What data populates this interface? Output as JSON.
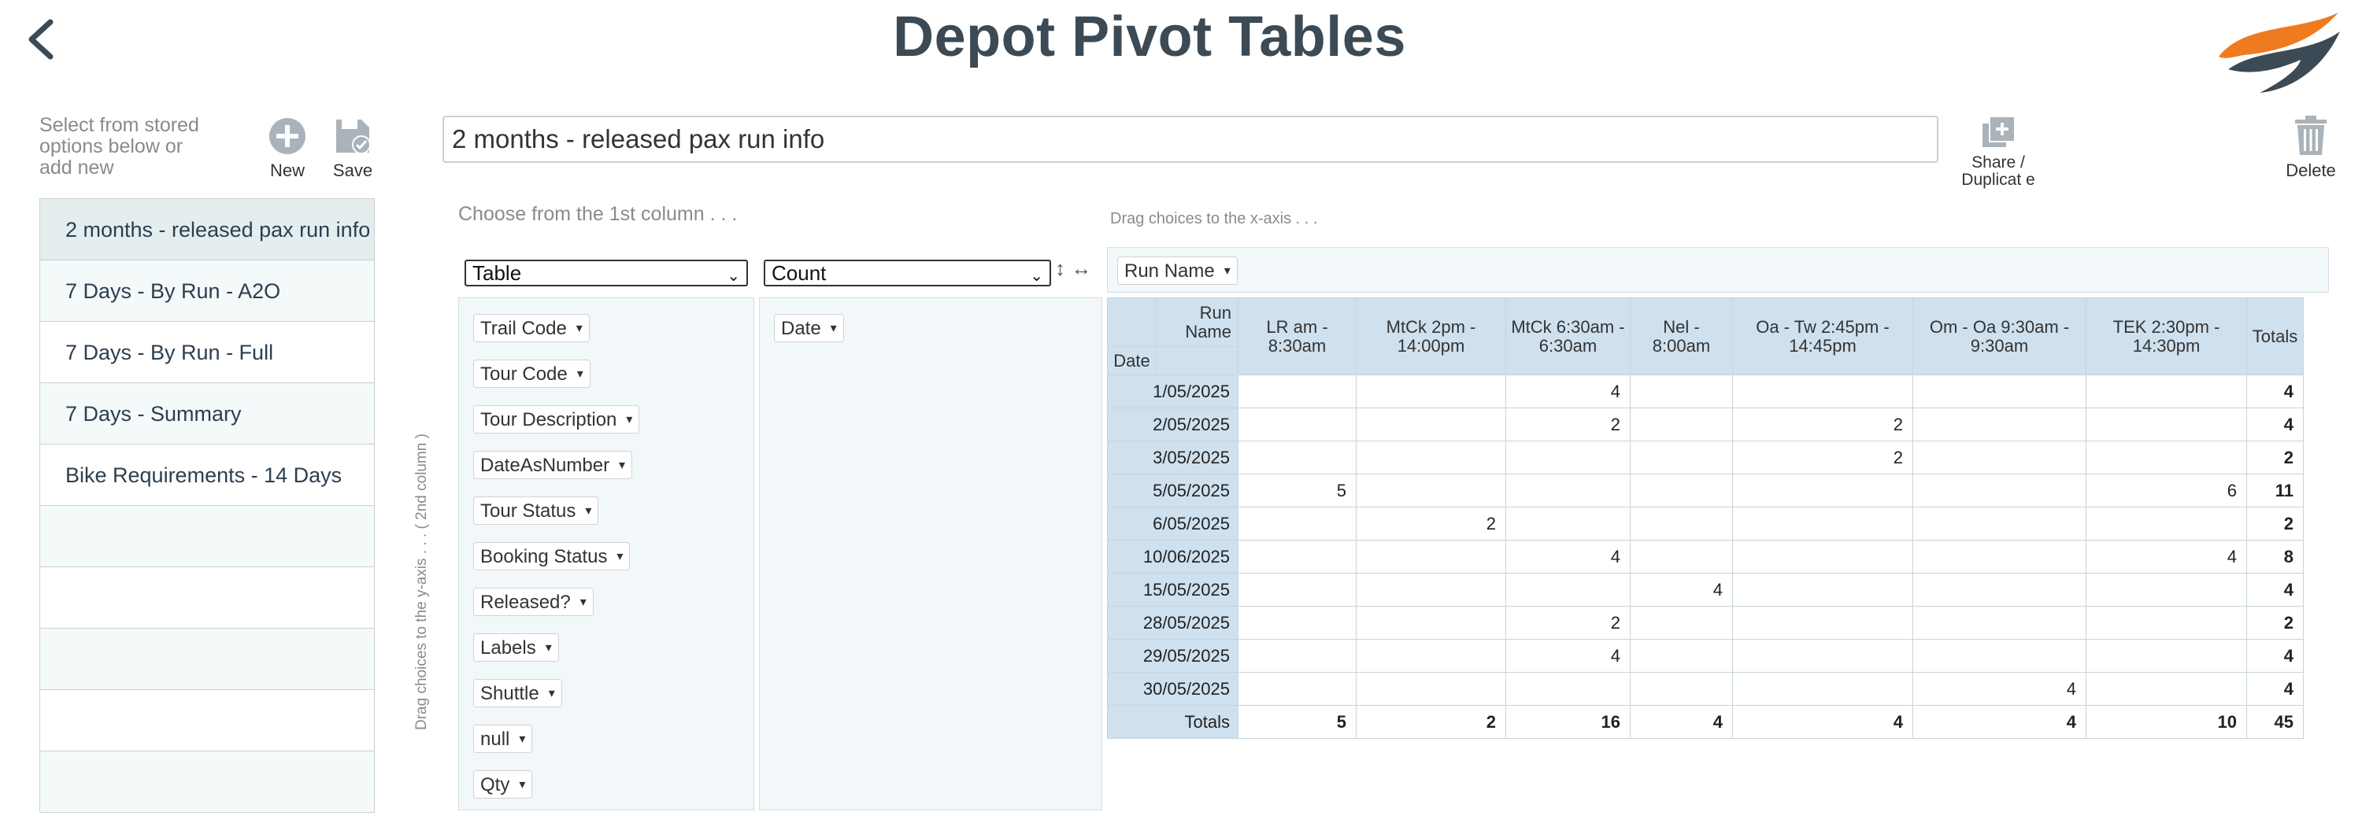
{
  "header": {
    "title": "Depot Pivot Tables"
  },
  "stored": {
    "hint": "Select from stored options below or add new",
    "new_label": "New",
    "save_label": "Save",
    "items": [
      {
        "label": "2 months - released pax run info"
      },
      {
        "label": "7 Days - By Run - A2O"
      },
      {
        "label": "7 Days - By Run - Full"
      },
      {
        "label": "7 Days - Summary"
      },
      {
        "label": "Bike Requirements - 14 Days"
      },
      {
        "label": ""
      },
      {
        "label": ""
      },
      {
        "label": ""
      },
      {
        "label": ""
      },
      {
        "label": ""
      }
    ]
  },
  "editor": {
    "name_value": "2 months - released pax run info",
    "share_label": "Share / Duplicat e",
    "delete_label": "Delete",
    "choose_hint": "Choose from the 1st column . . .",
    "xaxis_hint": "Drag choices to the x-axis . . .",
    "yaxis_hint": "Drag choices to the y-axis . . . ( 2nd column )",
    "renderer": "Table",
    "aggregator": "Count"
  },
  "fields": [
    "Trail Code",
    "Tour Code",
    "Tour Description",
    "DateAsNumber",
    "Tour Status",
    "Booking Status",
    "Released?",
    "Labels",
    "Shuttle",
    "null",
    "Qty"
  ],
  "row_field": "Date",
  "col_field": "Run Name",
  "pivot": {
    "row_axis_label": "Date",
    "col_axis_label": "Run Name",
    "columns": [
      "LR am - 8:30am",
      "MtCk 2pm - 14:00pm",
      "MtCk 6:30am - 6:30am",
      "Nel - 8:00am",
      "Oa - Tw 2:45pm - 14:45pm",
      "Om - Oa 9:30am - 9:30am",
      "TEK 2:30pm - 14:30pm"
    ],
    "totals_label": "Totals",
    "rows": [
      {
        "date": "1/05/2025",
        "values": [
          "",
          "",
          "4",
          "",
          "",
          "",
          ""
        ],
        "total": "4"
      },
      {
        "date": "2/05/2025",
        "values": [
          "",
          "",
          "2",
          "",
          "2",
          "",
          ""
        ],
        "total": "4"
      },
      {
        "date": "3/05/2025",
        "values": [
          "",
          "",
          "",
          "",
          "2",
          "",
          ""
        ],
        "total": "2"
      },
      {
        "date": "5/05/2025",
        "values": [
          "5",
          "",
          "",
          "",
          "",
          "",
          "6"
        ],
        "total": "11"
      },
      {
        "date": "6/05/2025",
        "values": [
          "",
          "2",
          "",
          "",
          "",
          "",
          ""
        ],
        "total": "2"
      },
      {
        "date": "10/06/2025",
        "values": [
          "",
          "",
          "4",
          "",
          "",
          "",
          "4"
        ],
        "total": "8"
      },
      {
        "date": "15/05/2025",
        "values": [
          "",
          "",
          "",
          "4",
          "",
          "",
          ""
        ],
        "total": "4"
      },
      {
        "date": "28/05/2025",
        "values": [
          "",
          "",
          "2",
          "",
          "",
          "",
          ""
        ],
        "total": "2"
      },
      {
        "date": "29/05/2025",
        "values": [
          "",
          "",
          "4",
          "",
          "",
          "",
          ""
        ],
        "total": "4"
      },
      {
        "date": "30/05/2025",
        "values": [
          "",
          "",
          "",
          "",
          "",
          "4",
          ""
        ],
        "total": "4"
      }
    ],
    "col_totals": [
      "5",
      "2",
      "16",
      "4",
      "4",
      "4",
      "10"
    ],
    "grand_total": "45"
  },
  "colors": {
    "title": "#3b4a55",
    "header_cell": "#cfe0ee",
    "panel_bg": "#f2f7f9",
    "icon_gray": "#a9b3b9",
    "logo_orange": "#f07a1f",
    "logo_dark": "#3c4a55"
  }
}
